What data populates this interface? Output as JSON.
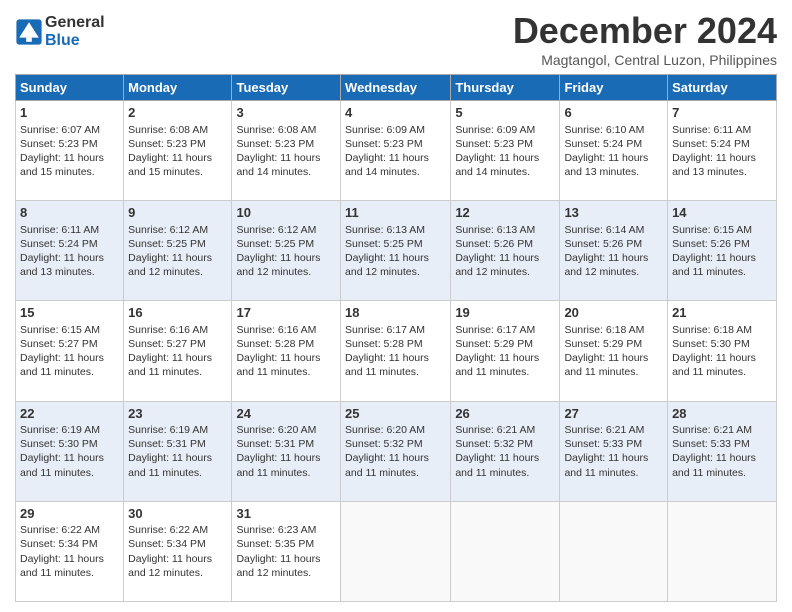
{
  "header": {
    "logo_line1": "General",
    "logo_line2": "Blue",
    "month_title": "December 2024",
    "location": "Magtangol, Central Luzon, Philippines"
  },
  "days_of_week": [
    "Sunday",
    "Monday",
    "Tuesday",
    "Wednesday",
    "Thursday",
    "Friday",
    "Saturday"
  ],
  "weeks": [
    [
      {
        "day": 1,
        "lines": [
          "Sunrise: 6:07 AM",
          "Sunset: 5:23 PM",
          "Daylight: 11 hours",
          "and 15 minutes."
        ]
      },
      {
        "day": 2,
        "lines": [
          "Sunrise: 6:08 AM",
          "Sunset: 5:23 PM",
          "Daylight: 11 hours",
          "and 15 minutes."
        ]
      },
      {
        "day": 3,
        "lines": [
          "Sunrise: 6:08 AM",
          "Sunset: 5:23 PM",
          "Daylight: 11 hours",
          "and 14 minutes."
        ]
      },
      {
        "day": 4,
        "lines": [
          "Sunrise: 6:09 AM",
          "Sunset: 5:23 PM",
          "Daylight: 11 hours",
          "and 14 minutes."
        ]
      },
      {
        "day": 5,
        "lines": [
          "Sunrise: 6:09 AM",
          "Sunset: 5:23 PM",
          "Daylight: 11 hours",
          "and 14 minutes."
        ]
      },
      {
        "day": 6,
        "lines": [
          "Sunrise: 6:10 AM",
          "Sunset: 5:24 PM",
          "Daylight: 11 hours",
          "and 13 minutes."
        ]
      },
      {
        "day": 7,
        "lines": [
          "Sunrise: 6:11 AM",
          "Sunset: 5:24 PM",
          "Daylight: 11 hours",
          "and 13 minutes."
        ]
      }
    ],
    [
      {
        "day": 8,
        "lines": [
          "Sunrise: 6:11 AM",
          "Sunset: 5:24 PM",
          "Daylight: 11 hours",
          "and 13 minutes."
        ]
      },
      {
        "day": 9,
        "lines": [
          "Sunrise: 6:12 AM",
          "Sunset: 5:25 PM",
          "Daylight: 11 hours",
          "and 12 minutes."
        ]
      },
      {
        "day": 10,
        "lines": [
          "Sunrise: 6:12 AM",
          "Sunset: 5:25 PM",
          "Daylight: 11 hours",
          "and 12 minutes."
        ]
      },
      {
        "day": 11,
        "lines": [
          "Sunrise: 6:13 AM",
          "Sunset: 5:25 PM",
          "Daylight: 11 hours",
          "and 12 minutes."
        ]
      },
      {
        "day": 12,
        "lines": [
          "Sunrise: 6:13 AM",
          "Sunset: 5:26 PM",
          "Daylight: 11 hours",
          "and 12 minutes."
        ]
      },
      {
        "day": 13,
        "lines": [
          "Sunrise: 6:14 AM",
          "Sunset: 5:26 PM",
          "Daylight: 11 hours",
          "and 12 minutes."
        ]
      },
      {
        "day": 14,
        "lines": [
          "Sunrise: 6:15 AM",
          "Sunset: 5:26 PM",
          "Daylight: 11 hours",
          "and 11 minutes."
        ]
      }
    ],
    [
      {
        "day": 15,
        "lines": [
          "Sunrise: 6:15 AM",
          "Sunset: 5:27 PM",
          "Daylight: 11 hours",
          "and 11 minutes."
        ]
      },
      {
        "day": 16,
        "lines": [
          "Sunrise: 6:16 AM",
          "Sunset: 5:27 PM",
          "Daylight: 11 hours",
          "and 11 minutes."
        ]
      },
      {
        "day": 17,
        "lines": [
          "Sunrise: 6:16 AM",
          "Sunset: 5:28 PM",
          "Daylight: 11 hours",
          "and 11 minutes."
        ]
      },
      {
        "day": 18,
        "lines": [
          "Sunrise: 6:17 AM",
          "Sunset: 5:28 PM",
          "Daylight: 11 hours",
          "and 11 minutes."
        ]
      },
      {
        "day": 19,
        "lines": [
          "Sunrise: 6:17 AM",
          "Sunset: 5:29 PM",
          "Daylight: 11 hours",
          "and 11 minutes."
        ]
      },
      {
        "day": 20,
        "lines": [
          "Sunrise: 6:18 AM",
          "Sunset: 5:29 PM",
          "Daylight: 11 hours",
          "and 11 minutes."
        ]
      },
      {
        "day": 21,
        "lines": [
          "Sunrise: 6:18 AM",
          "Sunset: 5:30 PM",
          "Daylight: 11 hours",
          "and 11 minutes."
        ]
      }
    ],
    [
      {
        "day": 22,
        "lines": [
          "Sunrise: 6:19 AM",
          "Sunset: 5:30 PM",
          "Daylight: 11 hours",
          "and 11 minutes."
        ]
      },
      {
        "day": 23,
        "lines": [
          "Sunrise: 6:19 AM",
          "Sunset: 5:31 PM",
          "Daylight: 11 hours",
          "and 11 minutes."
        ]
      },
      {
        "day": 24,
        "lines": [
          "Sunrise: 6:20 AM",
          "Sunset: 5:31 PM",
          "Daylight: 11 hours",
          "and 11 minutes."
        ]
      },
      {
        "day": 25,
        "lines": [
          "Sunrise: 6:20 AM",
          "Sunset: 5:32 PM",
          "Daylight: 11 hours",
          "and 11 minutes."
        ]
      },
      {
        "day": 26,
        "lines": [
          "Sunrise: 6:21 AM",
          "Sunset: 5:32 PM",
          "Daylight: 11 hours",
          "and 11 minutes."
        ]
      },
      {
        "day": 27,
        "lines": [
          "Sunrise: 6:21 AM",
          "Sunset: 5:33 PM",
          "Daylight: 11 hours",
          "and 11 minutes."
        ]
      },
      {
        "day": 28,
        "lines": [
          "Sunrise: 6:21 AM",
          "Sunset: 5:33 PM",
          "Daylight: 11 hours",
          "and 11 minutes."
        ]
      }
    ],
    [
      {
        "day": 29,
        "lines": [
          "Sunrise: 6:22 AM",
          "Sunset: 5:34 PM",
          "Daylight: 11 hours",
          "and 11 minutes."
        ]
      },
      {
        "day": 30,
        "lines": [
          "Sunrise: 6:22 AM",
          "Sunset: 5:34 PM",
          "Daylight: 11 hours",
          "and 12 minutes."
        ]
      },
      {
        "day": 31,
        "lines": [
          "Sunrise: 6:23 AM",
          "Sunset: 5:35 PM",
          "Daylight: 11 hours",
          "and 12 minutes."
        ]
      },
      null,
      null,
      null,
      null
    ]
  ]
}
